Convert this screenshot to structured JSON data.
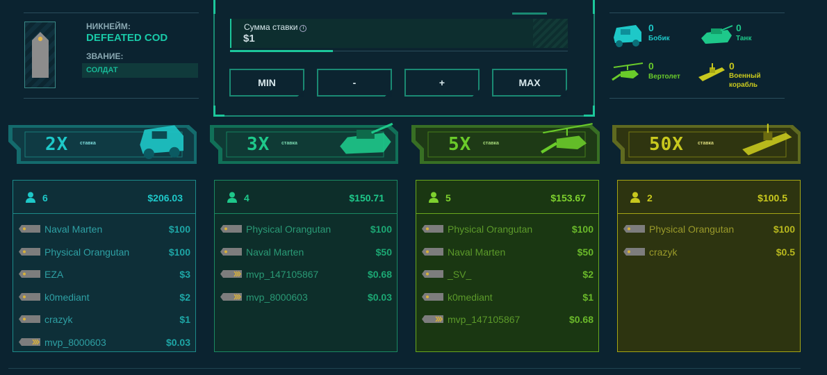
{
  "profile": {
    "nick_label": "НИКНЕЙМ:",
    "nick_value": "DEFEATED COD",
    "rank_label": "ЗВАНИЕ:",
    "rank_value": "СОЛДАТ"
  },
  "bet": {
    "label": "Сумма ставки",
    "value": "$1",
    "buttons": [
      "MIN",
      "-",
      "+",
      "MAX"
    ]
  },
  "legend": [
    {
      "count": "0",
      "name": "Бобик",
      "icon": "armored-car-icon",
      "color": "#1ec8c8"
    },
    {
      "count": "0",
      "name": "Танк",
      "icon": "tank-icon",
      "color": "#1ec88a"
    },
    {
      "count": "0",
      "name": "Вертолет",
      "icon": "helicopter-icon",
      "color": "#6acb2a"
    },
    {
      "count": "0",
      "name": "Военный корабль",
      "icon": "warship-icon",
      "color": "#c8c81e"
    }
  ],
  "banners": [
    {
      "mult": "2X",
      "sub": "ставка",
      "icon": "armored-car-icon",
      "color": "#1ec8c8"
    },
    {
      "mult": "3X",
      "sub": "ставка",
      "icon": "tank-icon",
      "color": "#1ec88a"
    },
    {
      "mult": "5X",
      "sub": "ставка",
      "icon": "helicopter-icon",
      "color": "#6acb2a"
    },
    {
      "mult": "50X",
      "sub": "ставка",
      "icon": "warship-icon",
      "color": "#c8c81e"
    }
  ],
  "columns": [
    {
      "count": "6",
      "total": "$206.03",
      "rows": [
        {
          "name": "Naval Marten",
          "amount": "$100"
        },
        {
          "name": "Physical Orangutan",
          "amount": "$100"
        },
        {
          "name": "EZA",
          "amount": "$3"
        },
        {
          "name": "k0mediant",
          "amount": "$2"
        },
        {
          "name": "crazyk",
          "amount": "$1"
        },
        {
          "name": "mvp_8000603",
          "amount": "$0.03"
        }
      ]
    },
    {
      "count": "4",
      "total": "$150.71",
      "rows": [
        {
          "name": "Physical Orangutan",
          "amount": "$100"
        },
        {
          "name": "Naval Marten",
          "amount": "$50"
        },
        {
          "name": "mvp_147105867",
          "amount": "$0.68"
        },
        {
          "name": "mvp_8000603",
          "amount": "$0.03"
        }
      ]
    },
    {
      "count": "5",
      "total": "$153.67",
      "rows": [
        {
          "name": "Physical Orangutan",
          "amount": "$100"
        },
        {
          "name": "Naval Marten",
          "amount": "$50"
        },
        {
          "name": "_SV_",
          "amount": "$2"
        },
        {
          "name": "k0mediant",
          "amount": "$1"
        },
        {
          "name": "mvp_147105867",
          "amount": "$0.68"
        }
      ]
    },
    {
      "count": "2",
      "total": "$100.5",
      "rows": [
        {
          "name": "Physical Orangutan",
          "amount": "$100"
        },
        {
          "name": "crazyk",
          "amount": "$0.5"
        }
      ]
    }
  ]
}
